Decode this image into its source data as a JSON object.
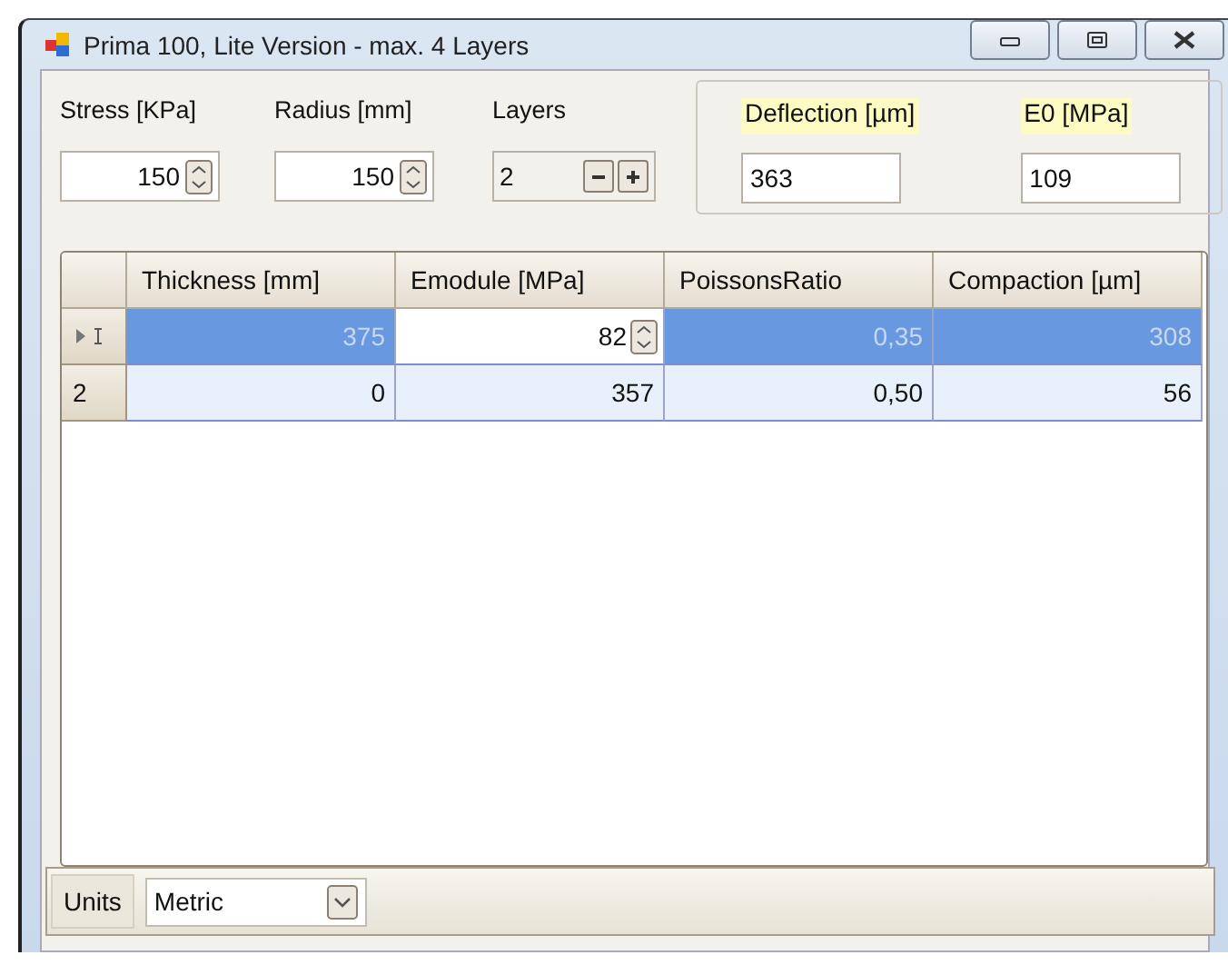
{
  "window": {
    "title": "Prima 100, Lite Version - max. 4 Layers"
  },
  "inputs": [
    {
      "label": "Stress [KPa]",
      "value": "150",
      "kind": "spin"
    },
    {
      "label": "Radius [mm]",
      "value": "150",
      "kind": "spin"
    },
    {
      "label": "Layers",
      "value": "2",
      "kind": "stepper"
    }
  ],
  "results": [
    {
      "label": "Deflection [µm]",
      "value": "363"
    },
    {
      "label": "E0 [MPa]",
      "value": "109"
    }
  ],
  "table": {
    "columns": [
      "Thickness [mm]",
      "Emodule [MPa]",
      "PoissonsRatio",
      "Compaction [µm]"
    ],
    "rows": [
      {
        "selected": true,
        "cells": [
          {
            "text": "375",
            "editing": false
          },
          {
            "text": "82",
            "editing": true
          },
          {
            "text": "0,35",
            "editing": false
          },
          {
            "text": "308",
            "editing": false
          }
        ]
      },
      {
        "selected": false,
        "header": "2",
        "cells": [
          {
            "text": "0",
            "editing": false
          },
          {
            "text": "357",
            "editing": false
          },
          {
            "text": "0,50",
            "editing": false
          },
          {
            "text": "56",
            "editing": false
          }
        ]
      }
    ]
  },
  "status_bar": {
    "label": "Units",
    "dropdown": "Metric"
  }
}
